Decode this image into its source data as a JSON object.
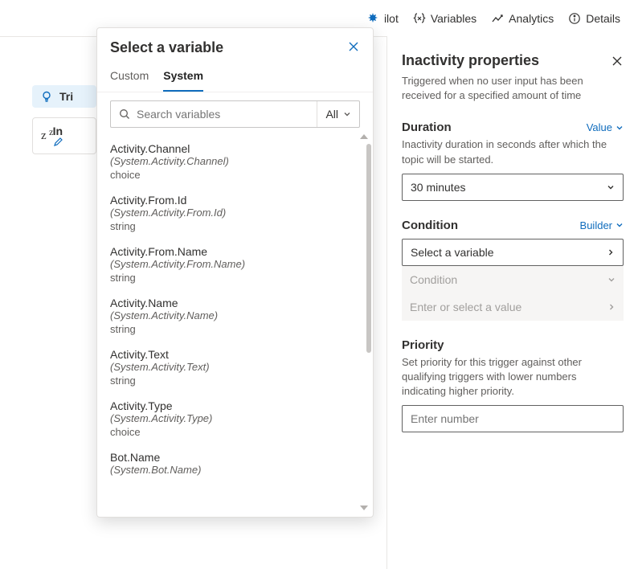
{
  "toolbar": {
    "copilot": "ilot",
    "variables": "Variables",
    "analytics": "Analytics",
    "details": "Details"
  },
  "canvas": {
    "trigger_label": "Tri",
    "inact_label": "In"
  },
  "popover": {
    "title": "Select a variable",
    "tab_custom": "Custom",
    "tab_system": "System",
    "search_placeholder": "Search variables",
    "filter_label": "All"
  },
  "variables": [
    {
      "name": "Activity.Channel",
      "path": "(System.Activity.Channel)",
      "type": "choice"
    },
    {
      "name": "Activity.From.Id",
      "path": "(System.Activity.From.Id)",
      "type": "string"
    },
    {
      "name": "Activity.From.Name",
      "path": "(System.Activity.From.Name)",
      "type": "string"
    },
    {
      "name": "Activity.Name",
      "path": "(System.Activity.Name)",
      "type": "string"
    },
    {
      "name": "Activity.Text",
      "path": "(System.Activity.Text)",
      "type": "string"
    },
    {
      "name": "Activity.Type",
      "path": "(System.Activity.Type)",
      "type": "choice"
    },
    {
      "name": "Bot.Name",
      "path": "(System.Bot.Name)",
      "type": ""
    }
  ],
  "panel": {
    "title": "Inactivity properties",
    "desc": "Triggered when no user input has been received for a specified amount of time",
    "duration_label": "Duration",
    "duration_mode": "Value",
    "duration_desc": "Inactivity duration in seconds after which the topic will be started.",
    "duration_value": "30 minutes",
    "condition_label": "Condition",
    "condition_mode": "Builder",
    "select_variable": "Select a variable",
    "condition_placeholder": "Condition",
    "value_placeholder": "Enter or select a value",
    "priority_label": "Priority",
    "priority_desc": "Set priority for this trigger against other qualifying triggers with lower numbers indicating higher priority.",
    "priority_placeholder": "Enter number"
  }
}
